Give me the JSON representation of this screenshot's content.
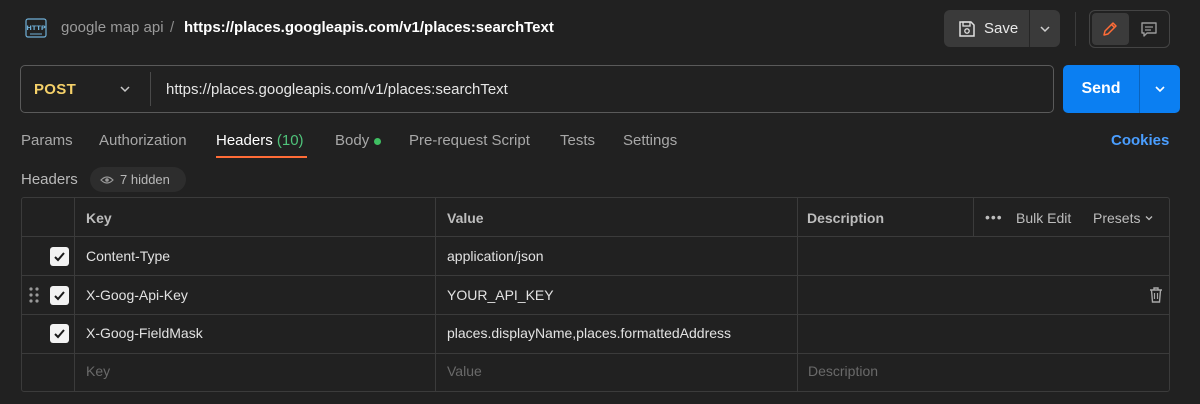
{
  "breadcrumb": {
    "parent": "google map api",
    "separator": "/",
    "current": "https://places.googleapis.com/v1/places:searchText"
  },
  "toolbar": {
    "save_label": "Save"
  },
  "request": {
    "method": "POST",
    "url": "https://places.googleapis.com/v1/places:searchText",
    "send_label": "Send"
  },
  "tabs": [
    {
      "label": "Params"
    },
    {
      "label": "Authorization"
    },
    {
      "label": "Headers",
      "count": "(10)"
    },
    {
      "label": "Body"
    },
    {
      "label": "Pre-request Script"
    },
    {
      "label": "Tests"
    },
    {
      "label": "Settings"
    }
  ],
  "cookies_label": "Cookies",
  "headers_section": {
    "label": "Headers",
    "hidden_text": "7 hidden"
  },
  "table": {
    "columns": {
      "key": "Key",
      "value": "Value",
      "description": "Description"
    },
    "bulk_edit": "Bulk Edit",
    "presets": "Presets",
    "rows": [
      {
        "key": "Content-Type",
        "value": "application/json",
        "checked": true
      },
      {
        "key": "X-Goog-Api-Key",
        "value": "YOUR_API_KEY",
        "checked": true
      },
      {
        "key": "X-Goog-FieldMask",
        "value": "places.displayName,places.formattedAddress",
        "checked": true
      }
    ],
    "placeholder": {
      "key": "Key",
      "value": "Value",
      "description": "Description"
    }
  },
  "colors": {
    "method": "#f5d169",
    "send": "#0b7ff2",
    "tab_underline": "#ff6c37",
    "cookies": "#4a9eff",
    "count": "#4fc37a"
  }
}
